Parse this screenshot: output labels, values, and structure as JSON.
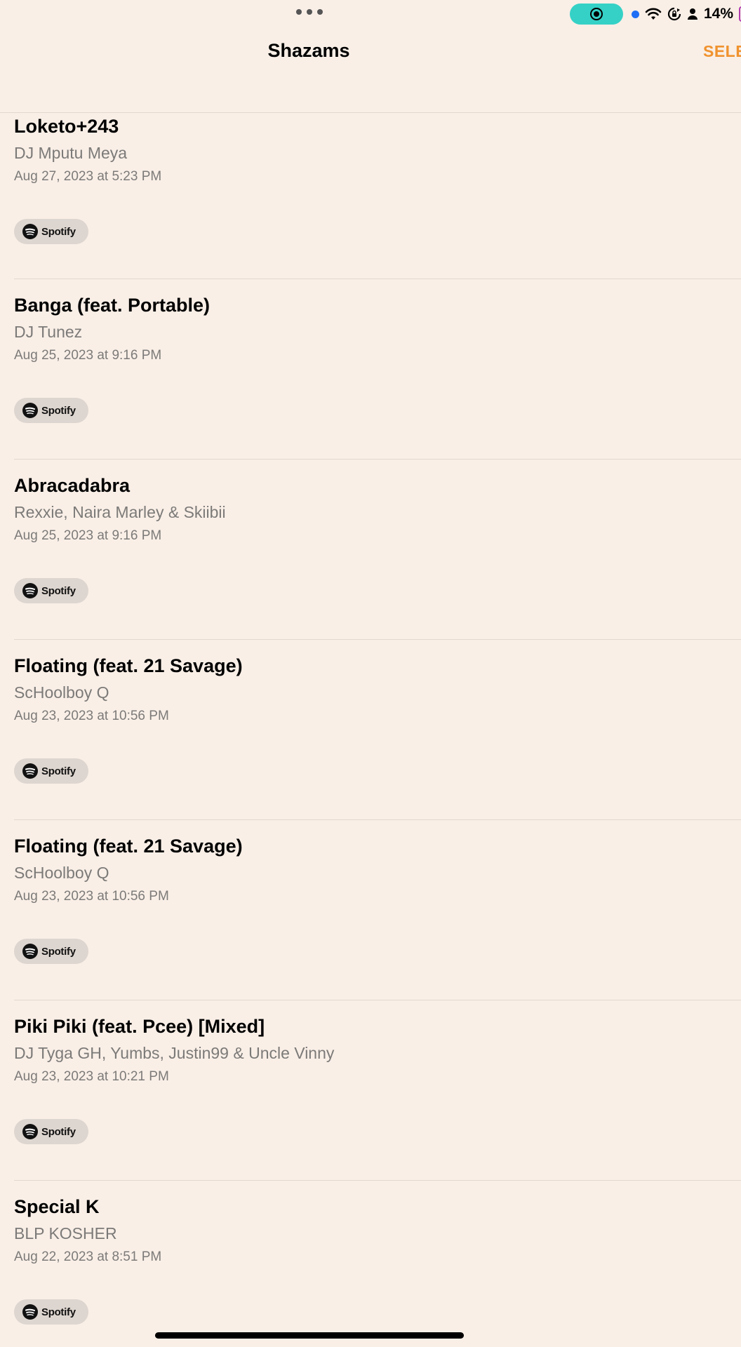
{
  "status_bar": {
    "battery_percent": "14%",
    "icons": [
      "more-dots-icon",
      "screen-record-icon",
      "location-dot-icon",
      "wifi-icon",
      "rotation-lock-icon",
      "person-icon",
      "battery-icon"
    ]
  },
  "nav": {
    "title": "Shazams",
    "select_label": "SELE"
  },
  "items": [
    {
      "title": "Loketo+243",
      "artist": "DJ Mputu Meya",
      "date": "Aug 27, 2023 at 5:23 PM",
      "service": "Spotify"
    },
    {
      "title": "Banga (feat. Portable)",
      "artist": "DJ Tunez",
      "date": "Aug 25, 2023 at 9:16 PM",
      "service": "Spotify"
    },
    {
      "title": "Abracadabra",
      "artist": "Rexxie, Naira Marley & Skiibii",
      "date": "Aug 25, 2023 at 9:16 PM",
      "service": "Spotify"
    },
    {
      "title": "Floating (feat. 21 Savage)",
      "artist": "ScHoolboy Q",
      "date": "Aug 23, 2023 at 10:56 PM",
      "service": "Spotify"
    },
    {
      "title": "Floating (feat. 21 Savage)",
      "artist": "ScHoolboy Q",
      "date": "Aug 23, 2023 at 10:56 PM",
      "service": "Spotify"
    },
    {
      "title": "Piki Piki (feat. Pcee) [Mixed]",
      "artist": "DJ Tyga GH, Yumbs, Justin99 & Uncle Vinny",
      "date": "Aug 23, 2023 at 10:21 PM",
      "service": "Spotify"
    },
    {
      "title": "Special K",
      "artist": "BLP KOSHER",
      "date": "Aug 22, 2023 at 8:51 PM",
      "service": "Spotify"
    }
  ],
  "colors": {
    "background": "#f9efe7",
    "accent": "#f0922e",
    "record_pill": "#35d1c6",
    "secondary_text": "#7c7a78"
  }
}
